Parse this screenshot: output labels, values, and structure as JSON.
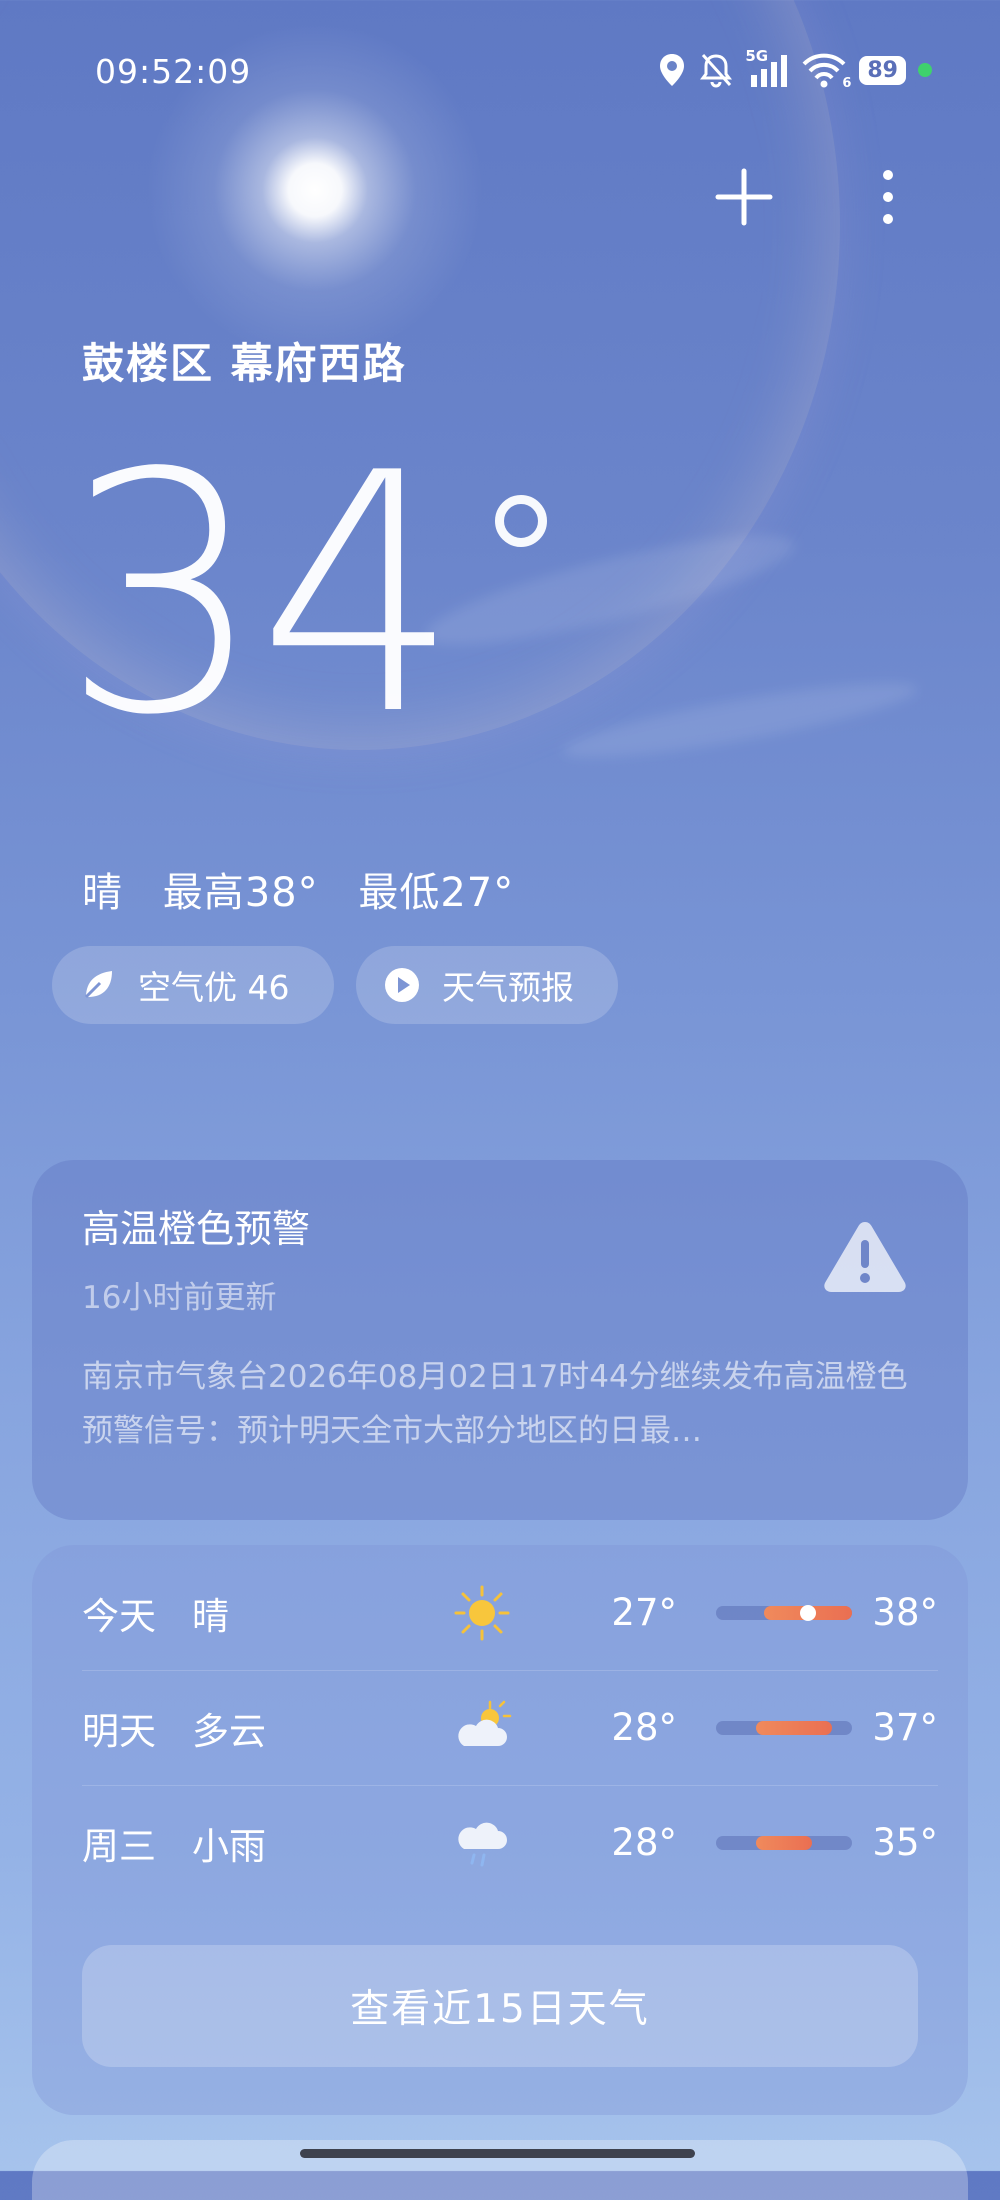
{
  "status_bar": {
    "time": "09:52:09",
    "network": "5G",
    "wifi_badge": "6",
    "battery": "89",
    "icons": [
      "location-icon",
      "mute-bell-icon",
      "signal-icon",
      "wifi-icon",
      "battery-icon"
    ],
    "dot_color": "#3fd16d"
  },
  "header": {
    "add_icon": "plus-icon",
    "menu_icon": "more-vert-icon"
  },
  "location": "鼓楼区 幕府西路",
  "current": {
    "temperature": "34",
    "condition": "晴",
    "high": "最高38°",
    "low": "最低27°"
  },
  "chips": {
    "aqi_label": "空气优 46",
    "forecast_label": "天气预报"
  },
  "alert": {
    "title": "高温橙色预警",
    "updated": "16小时前更新",
    "body": "南京市气象台2026年08月02日17时44分继续发布高温橙色预警信号：预计明天全市大部分地区的日最…",
    "icon": "warning-triangle-icon"
  },
  "forecast": {
    "days": [
      {
        "day": "今天",
        "condition": "晴",
        "icon": "sunny-icon",
        "low": "27°",
        "high": "38°",
        "range_start": 0.35,
        "range_end": 1.0,
        "current": 0.5
      },
      {
        "day": "明天",
        "condition": "多云",
        "icon": "partly-cloudy-icon",
        "low": "28°",
        "high": "37°",
        "range_start": 0.3,
        "range_end": 0.85
      },
      {
        "day": "周三",
        "condition": "小雨",
        "icon": "light-rain-icon",
        "low": "28°",
        "high": "35°",
        "range_start": 0.3,
        "range_end": 0.7
      }
    ],
    "more_button": "查看近15日天气"
  },
  "colors": {
    "bar_fill": "#ec7a55",
    "accent_dot": "#3fd16d"
  }
}
